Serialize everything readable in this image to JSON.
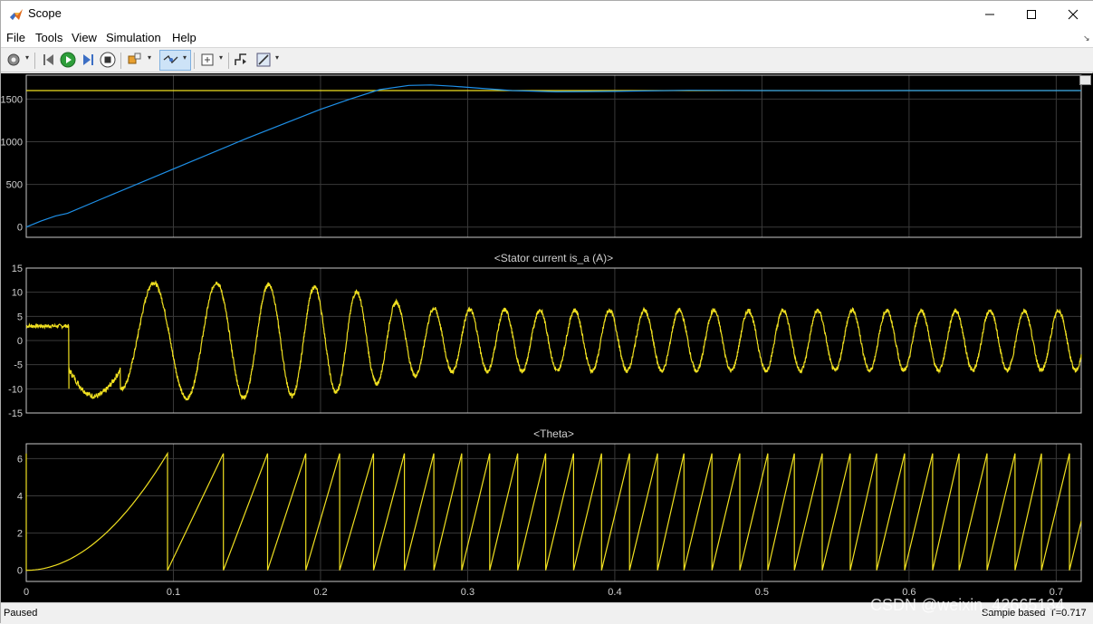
{
  "window": {
    "title": "Scope"
  },
  "menu": [
    "File",
    "Tools",
    "View",
    "Simulation",
    "Help"
  ],
  "toolbar": {
    "buttons": [
      "settings-icon",
      "step-back-icon",
      "run-icon",
      "step-forward-icon",
      "stop-icon",
      "highlight-icon",
      "zoom-icon",
      "autoscale-icon",
      "triggers-icon",
      "style-icon"
    ]
  },
  "status": {
    "left": "Paused",
    "mode": "Sample based",
    "time": "T=0.717"
  },
  "watermark": "CSDN @weixin_42665134",
  "colors": {
    "background": "#000000",
    "axis": "#d0d0d0",
    "grid": "#3a3a3a",
    "series_yellow": "#f0e020",
    "series_blue": "#1e90e8"
  },
  "chart_data": [
    {
      "type": "line",
      "title": "",
      "xlim": [
        0,
        0.717
      ],
      "ylim": [
        -120,
        1780
      ],
      "yticks": [
        0,
        500,
        1000,
        1500
      ],
      "xticks": [
        0,
        0.1,
        0.2,
        0.3,
        0.4,
        0.5,
        0.6,
        0.7
      ],
      "series": [
        {
          "color": "#f0e020",
          "x": [
            0,
            0.717
          ],
          "y": [
            1600,
            1600
          ]
        },
        {
          "color": "#1e90e8",
          "x": [
            0,
            0.01,
            0.02,
            0.028,
            0.05,
            0.1,
            0.15,
            0.2,
            0.22,
            0.24,
            0.26,
            0.275,
            0.29,
            0.31,
            0.33,
            0.36,
            0.4,
            0.45,
            0.5,
            0.55,
            0.6,
            0.65,
            0.717
          ],
          "y": [
            0,
            70,
            130,
            160,
            320,
            680,
            1040,
            1380,
            1500,
            1610,
            1660,
            1665,
            1650,
            1625,
            1600,
            1585,
            1590,
            1603,
            1600,
            1598,
            1600,
            1600,
            1600
          ]
        }
      ]
    },
    {
      "type": "line",
      "title": "<Stator current is_a (A)>",
      "xlim": [
        0,
        0.717
      ],
      "ylim": [
        -15,
        15
      ],
      "yticks": [
        -15,
        -10,
        -5,
        0,
        5,
        10,
        15
      ],
      "xticks": [
        0,
        0.1,
        0.2,
        0.3,
        0.4,
        0.5,
        0.6,
        0.7
      ],
      "series": [
        {
          "color": "#f0e020",
          "segments": [
            {
              "x0": 0,
              "x1": 0.029,
              "value": 3
            },
            {
              "x0": 0.029,
              "x1": 0.064,
              "value": -10
            },
            {
              "x0": 0.064,
              "x1": 0.717,
              "amplitude_points": [
                [
                  0.064,
                  10
                ],
                [
                  0.085,
                  12
                ],
                [
                  0.13,
                  12
                ],
                [
                  0.18,
                  11.5
                ],
                [
                  0.22,
                  10.5
                ],
                [
                  0.25,
                  8
                ],
                [
                  0.28,
                  6.5
                ],
                [
                  0.35,
                  6.3
                ],
                [
                  0.717,
                  6.2
                ]
              ],
              "frequency_points": [
                [
                  0.064,
                  22
                ],
                [
                  0.1,
                  22
                ],
                [
                  0.16,
                  30
                ],
                [
                  0.2,
                  34
                ],
                [
                  0.25,
                  38
                ],
                [
                  0.3,
                  42
                ],
                [
                  0.717,
                  43
                ]
              ]
            }
          ]
        }
      ]
    },
    {
      "type": "line",
      "title": "<Theta>",
      "xlim": [
        0,
        0.717
      ],
      "ylim": [
        -0.6,
        6.8
      ],
      "yticks": [
        0,
        2,
        4,
        6
      ],
      "xticks": [
        0,
        0.1,
        0.2,
        0.3,
        0.4,
        0.5,
        0.6,
        0.7
      ],
      "xticklabels": [
        "0",
        "0.1",
        "0.2",
        "0.3",
        "0.4",
        "0.5",
        "0.6",
        "0.7"
      ],
      "series": [
        {
          "color": "#f0e020",
          "wrap_times": [
            0.096,
            0.134,
            0.164,
            0.19,
            0.213,
            0.236,
            0.257,
            0.277,
            0.296,
            0.315,
            0.334,
            0.353,
            0.372,
            0.391,
            0.41,
            0.429,
            0.447,
            0.466,
            0.485,
            0.504,
            0.522,
            0.541,
            0.56,
            0.578,
            0.597,
            0.616,
            0.634,
            0.653,
            0.672,
            0.69,
            0.709
          ],
          "start_shape": {
            "x0": 0,
            "x1": 0.096,
            "y0": 0,
            "y1": 6.28,
            "kind": "parabolic"
          },
          "max": 6.28
        }
      ]
    }
  ]
}
